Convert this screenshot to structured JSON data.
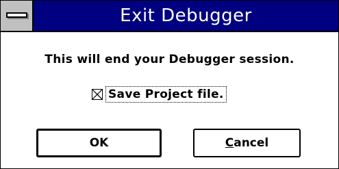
{
  "window": {
    "title": "Exit Debugger"
  },
  "dialog": {
    "message": "This will end your Debugger session.",
    "checkbox": {
      "label": "Save Project file.",
      "checked": true
    },
    "buttons": {
      "ok_label": "OK",
      "cancel_label": "Cancel"
    }
  },
  "icons": {
    "system_menu": "system-menu-icon",
    "checkbox_mark": "x-mark-icon"
  },
  "colors": {
    "titlebar": "#000080",
    "title_text": "#ffffff",
    "system_menu_bg": "#c0c0c0",
    "dialog_bg": "#ffffff"
  }
}
